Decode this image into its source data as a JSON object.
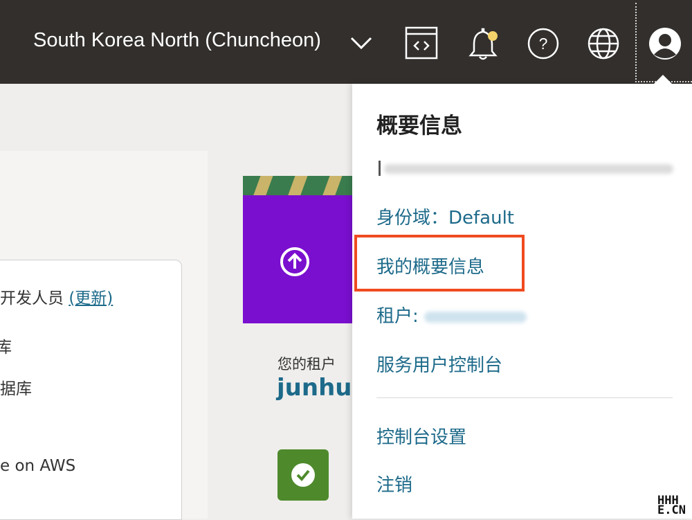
{
  "topbar": {
    "region_label": "South Korea North (Chuncheon)",
    "icons": [
      "code-editor-icon",
      "bell-icon",
      "help-icon",
      "globe-icon",
      "user-avatar-icon"
    ],
    "notification_dot_color": "#f5d36b"
  },
  "background": {
    "card_items": [
      "开发人员",
      "(更新)",
      "库",
      "据库",
      "e on AWS"
    ],
    "tenant_label": "您的租户",
    "tenant_value": "junhua"
  },
  "profile_menu": {
    "title": "概要信息",
    "identity_domain": "身份域：Default",
    "my_profile": "我的概要信息",
    "tenancy_label": "租户:",
    "service_user_console": "服务用户控制台",
    "console_settings": "控制台设置",
    "sign_out": "注销",
    "highlight_color": "#f04a20"
  },
  "watermark": {
    "line1": "HHH",
    "line2": "E.CN"
  }
}
